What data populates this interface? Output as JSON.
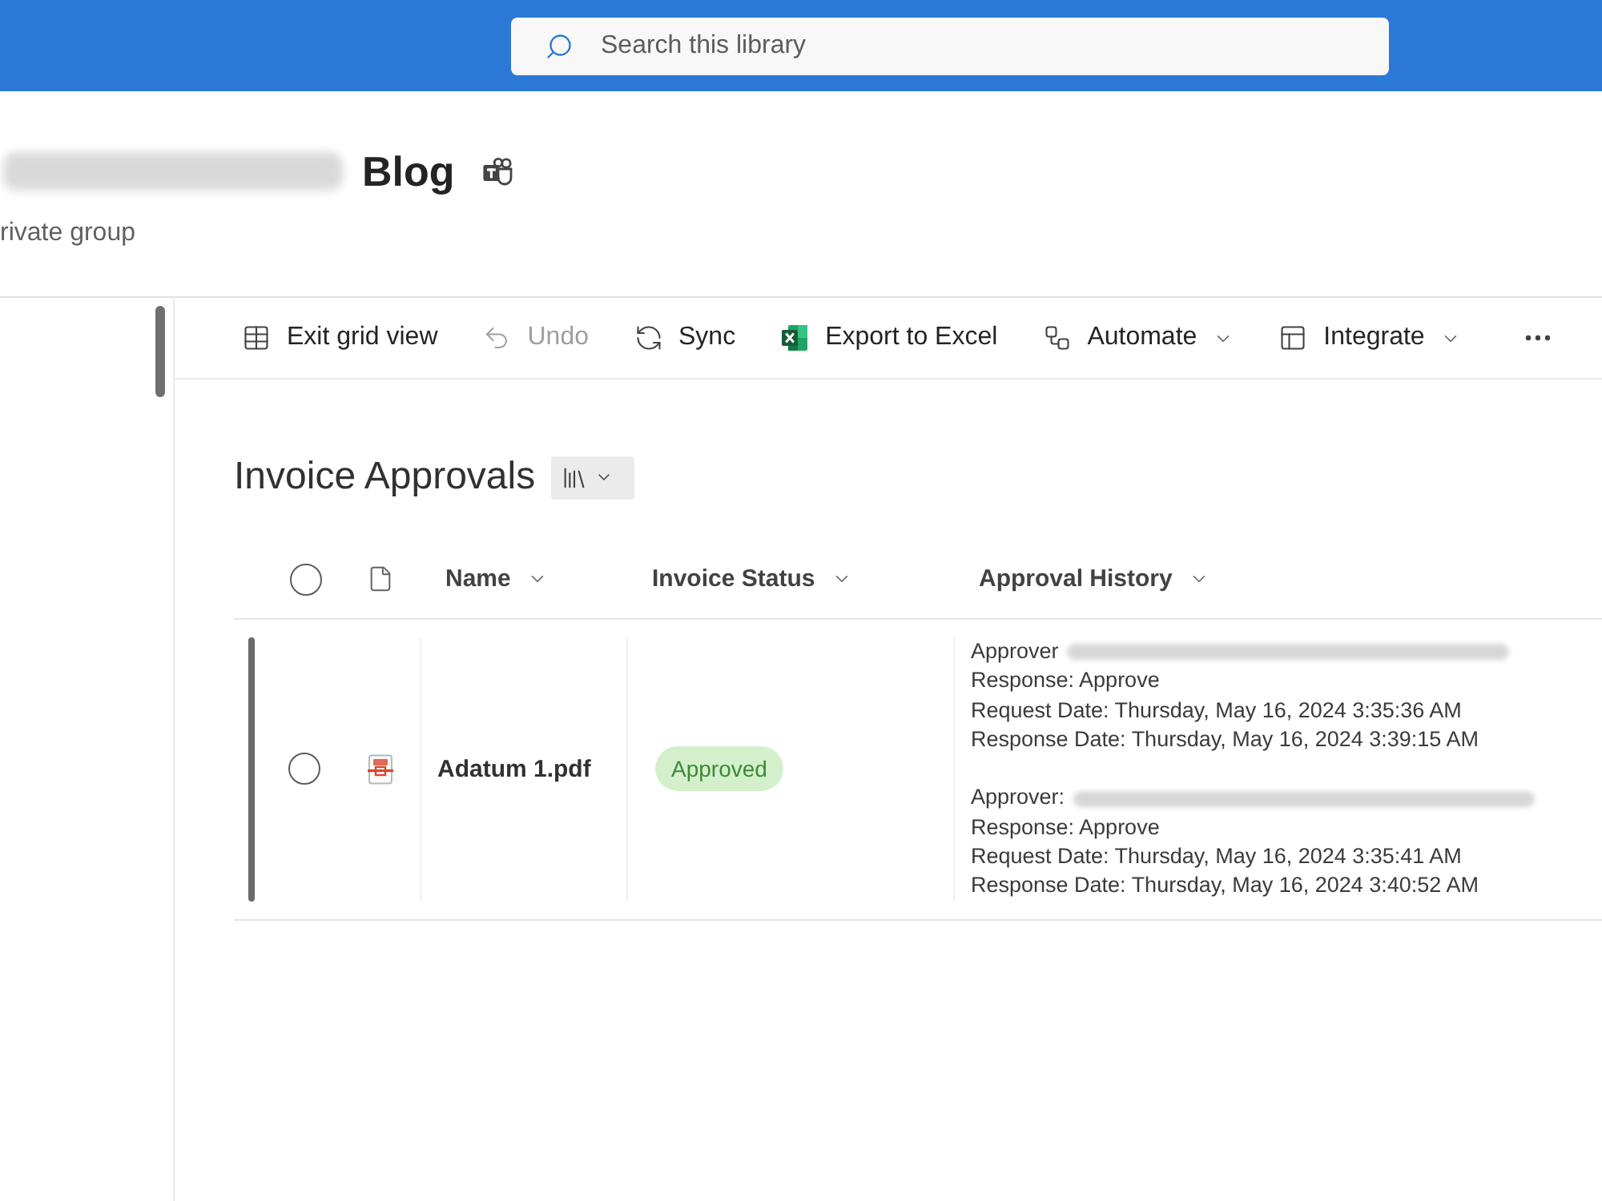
{
  "search": {
    "placeholder": "Search this library"
  },
  "site": {
    "title": "Blog",
    "subtitle": "rivate group"
  },
  "toolbar": [
    {
      "kind": "grid",
      "label": "Exit grid view",
      "disabled": false,
      "menu": false
    },
    {
      "kind": "undo",
      "label": "Undo",
      "disabled": true,
      "menu": false
    },
    {
      "kind": "sync",
      "label": "Sync",
      "disabled": false,
      "menu": false
    },
    {
      "kind": "excel",
      "label": "Export to Excel",
      "disabled": false,
      "menu": false
    },
    {
      "kind": "automate",
      "label": "Automate",
      "disabled": false,
      "menu": true
    },
    {
      "kind": "integrate",
      "label": "Integrate",
      "disabled": false,
      "menu": true
    },
    {
      "kind": "more",
      "disabled": false,
      "menu": false
    }
  ],
  "list": {
    "title": "Invoice Approvals"
  },
  "table": {
    "select_all": {
      "checked": false
    },
    "columns": [
      {
        "label": "Name"
      },
      {
        "label": "Invoice Status"
      },
      {
        "label": "Approval History"
      }
    ],
    "rows": [
      {
        "selected": false,
        "focused": true,
        "name": "Adatum 1.pdf",
        "status": "Approved",
        "approval_history": [
          {
            "approver": "Approver",
            "response": "Response: Approve",
            "request_date": "Request Date: Thursday, May 16, 2024 3:35:36 AM",
            "response_date": "Response Date: Thursday, May 16, 2024 3:39:15 AM"
          },
          {
            "approver": "Approver:",
            "response": "Response: Approve",
            "request_date": "Request Date: Thursday, May 16, 2024 3:35:41 AM",
            "response_date": "Response Date: Thursday, May 16, 2024 3:40:52 AM"
          }
        ]
      }
    ]
  }
}
